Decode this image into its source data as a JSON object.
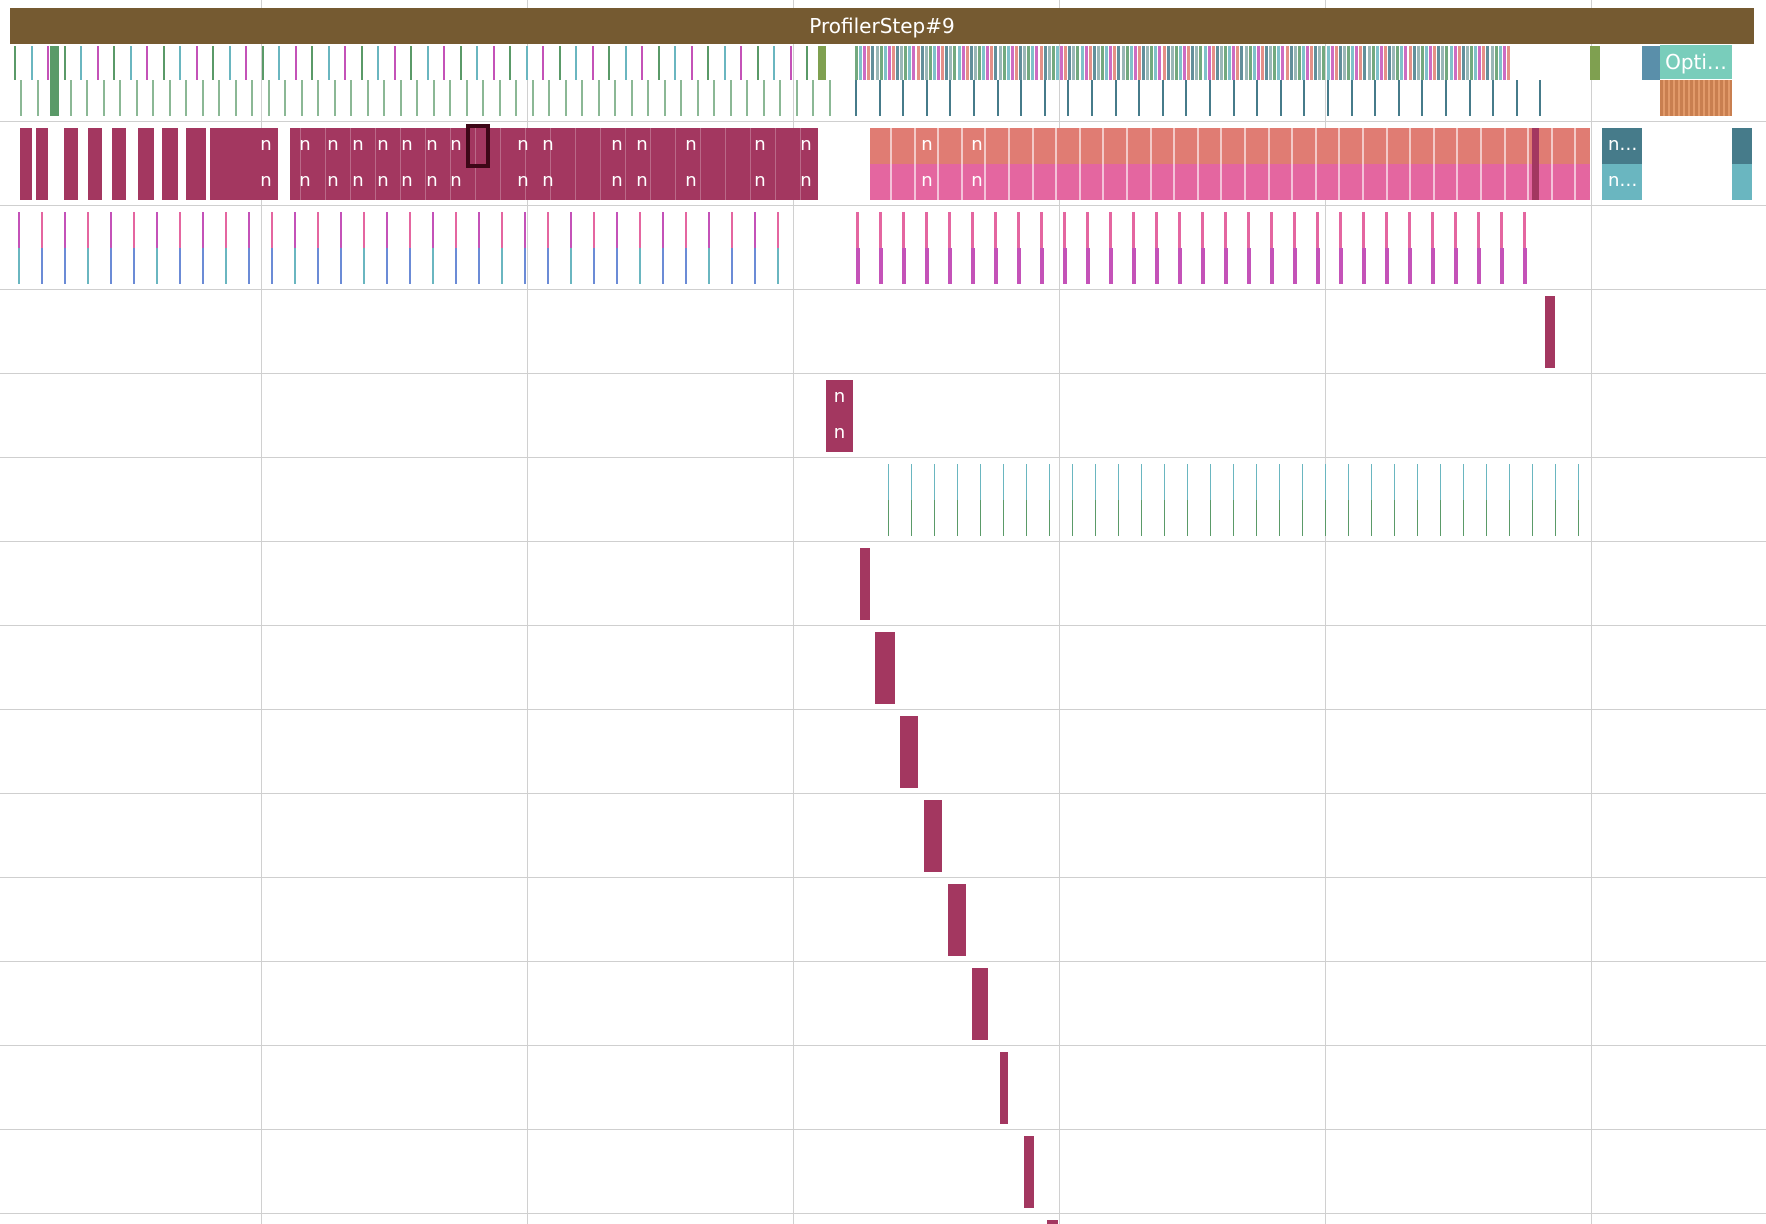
{
  "timeline": {
    "step_label": "ProfilerStep#9",
    "optimizer_label": "Opti…",
    "op_short_label": "n",
    "truncated_label": "n…"
  },
  "colors": {
    "step": "#755a31",
    "optimizer": "#79cdbb",
    "optimizer_sub": "#c97f50",
    "kernel": "#a33760",
    "kernel_salmon": "#e07c73",
    "kernel_pink": "#e466a0",
    "teal_dark": "#467b8a",
    "teal_light": "#6ab6c0",
    "green": "#5a9a68",
    "magenta": "#c452b8",
    "grid": "#d0d0d0"
  }
}
